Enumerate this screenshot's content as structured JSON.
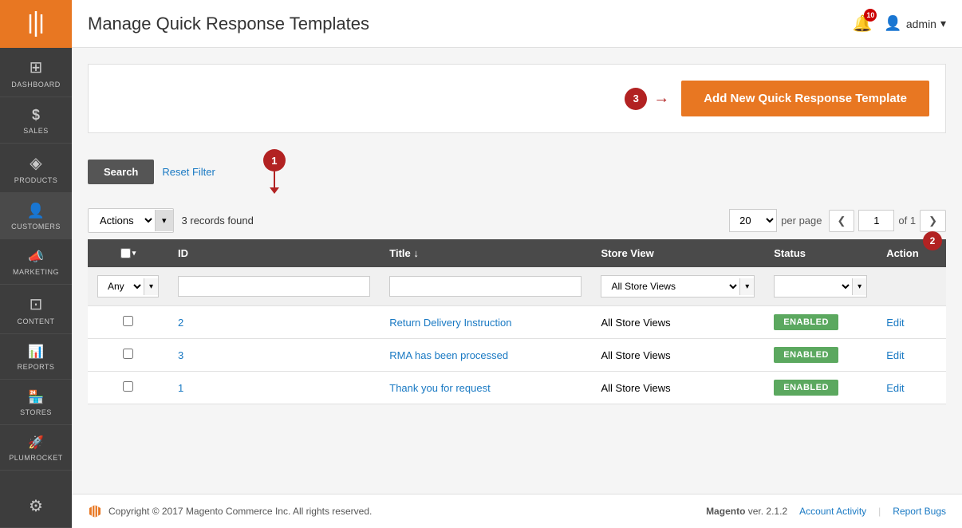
{
  "sidebar": {
    "logo_alt": "Magento Logo",
    "items": [
      {
        "id": "dashboard",
        "label": "DASHBOARD",
        "icon": "⊞"
      },
      {
        "id": "sales",
        "label": "SALES",
        "icon": "$"
      },
      {
        "id": "products",
        "label": "PRODUCTS",
        "icon": "◈"
      },
      {
        "id": "customers",
        "label": "CUSTOMERS",
        "icon": "👤"
      },
      {
        "id": "marketing",
        "label": "MARKETING",
        "icon": "📣"
      },
      {
        "id": "content",
        "label": "CONTENT",
        "icon": "⊡"
      },
      {
        "id": "reports",
        "label": "REPORTS",
        "icon": "📊"
      },
      {
        "id": "stores",
        "label": "STORES",
        "icon": "🏪"
      },
      {
        "id": "plumrocket",
        "label": "PLUMROCKET",
        "icon": "🚀"
      },
      {
        "id": "settings",
        "label": "",
        "icon": "⚙"
      }
    ]
  },
  "header": {
    "page_title": "Manage Quick Response Templates",
    "notification_count": "10",
    "admin_label": "admin"
  },
  "action_bar": {
    "step3_label": "3",
    "add_button_label": "Add New Quick Response Template"
  },
  "filters": {
    "search_button_label": "Search",
    "reset_label": "Reset Filter",
    "step1_label": "1"
  },
  "toolbar": {
    "actions_label": "Actions",
    "records_found": "3 records found",
    "per_page_value": "20",
    "per_page_label": "per page",
    "page_current": "1",
    "page_total": "of 1",
    "step2_label": "2"
  },
  "table": {
    "columns": [
      {
        "id": "check",
        "label": ""
      },
      {
        "id": "id",
        "label": "ID"
      },
      {
        "id": "title",
        "label": "Title"
      },
      {
        "id": "store_view",
        "label": "Store View"
      },
      {
        "id": "status",
        "label": "Status"
      },
      {
        "id": "action",
        "label": "Action"
      }
    ],
    "filter_row": {
      "any_label": "Any",
      "store_view_option": "All Store Views"
    },
    "rows": [
      {
        "id": "2",
        "title": "Return Delivery Instruction",
        "store_view": "All Store Views",
        "status": "ENABLED",
        "action": "Edit"
      },
      {
        "id": "3",
        "title": "RMA has been processed",
        "store_view": "All Store Views",
        "status": "ENABLED",
        "action": "Edit"
      },
      {
        "id": "1",
        "title": "Thank you for request",
        "store_view": "All Store Views",
        "status": "ENABLED",
        "action": "Edit"
      }
    ]
  },
  "footer": {
    "copyright": "Copyright © 2017 Magento Commerce Inc. All rights reserved.",
    "brand": "Magento",
    "version": "ver. 2.1.2",
    "account_activity_label": "Account Activity",
    "report_bugs_label": "Report Bugs"
  }
}
